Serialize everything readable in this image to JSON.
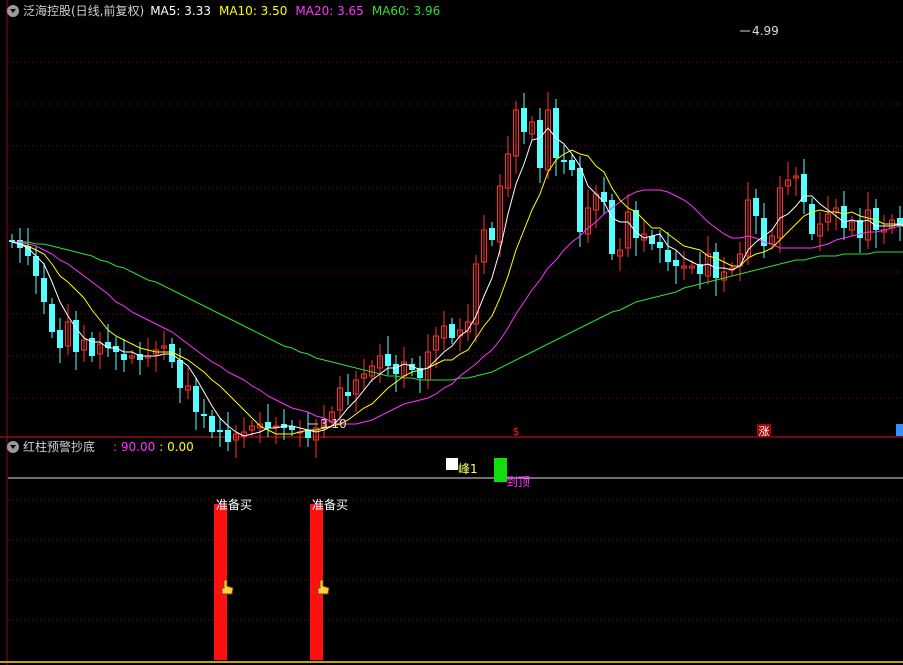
{
  "main_panel": {
    "title": "泛海控股(日线,前复权)",
    "ma_items": [
      {
        "label": "MA5",
        "value": "3.33",
        "color": "#ffffff"
      },
      {
        "label": "MA10",
        "value": "3.50",
        "color": "#ffff00"
      },
      {
        "label": "MA20",
        "value": "3.65",
        "color": "#ff33ff"
      },
      {
        "label": "MA60",
        "value": "3.96",
        "color": "#33dd33"
      }
    ]
  },
  "indicator_panel": {
    "title": "红柱预警抄底",
    "values": [
      {
        "text": ": 90.00",
        "color": "#ff33ff"
      },
      {
        "text": ": 0.00",
        "color": "#ffff00"
      }
    ]
  },
  "chart_data": {
    "type": "candlestick",
    "price_range": [
      3.0,
      5.05
    ],
    "high_marker": {
      "value": "4.99",
      "index": 91
    },
    "low_marker": {
      "value": "3.10",
      "index": 37
    },
    "event_markers": [
      {
        "text": "$",
        "index": 63,
        "color": "#ff2020"
      },
      {
        "text": "涨",
        "index": 94,
        "color": "#ffffff",
        "bg": "#aa0000"
      }
    ],
    "close": [
      3.95,
      3.92,
      3.88,
      3.78,
      3.65,
      3.5,
      3.42,
      3.55,
      3.4,
      3.46,
      3.38,
      3.44,
      3.42,
      3.4,
      3.36,
      3.38,
      3.36,
      3.38,
      3.41,
      3.43,
      3.35,
      3.22,
      3.23,
      3.1,
      3.08,
      3.0,
      3.0,
      2.95,
      2.99,
      3.0,
      3.03,
      3.04,
      3.02,
      3.03,
      3.02,
      3.01,
      3.0,
      2.97,
      3.02,
      3.06,
      3.1,
      3.22,
      3.18,
      3.26,
      3.29,
      3.33,
      3.38,
      3.33,
      3.29,
      3.35,
      3.31,
      3.27,
      3.4,
      3.48,
      3.53,
      3.47,
      3.51,
      3.55,
      3.84,
      4.01,
      3.96,
      4.23,
      4.39,
      4.61,
      4.5,
      4.55,
      4.32,
      4.61,
      4.37,
      4.35,
      4.31,
      4.0,
      4.12,
      4.19,
      4.15,
      3.89,
      3.91,
      4.1,
      3.97,
      3.99,
      3.94,
      3.92,
      3.85,
      3.83,
      3.83,
      3.83,
      3.79,
      3.89,
      3.77,
      3.8,
      3.82,
      3.89,
      4.16,
      4.08,
      3.93,
      3.98,
      4.22,
      4.26,
      4.28,
      4.15,
      3.99,
      4.04,
      4.09,
      4.12,
      4.02,
      4.05,
      3.97,
      4.11,
      4.01,
      4.01,
      4.06,
      4.03,
      3.93
    ],
    "open": [
      3.96,
      3.96,
      3.93,
      3.88,
      3.77,
      3.64,
      3.51,
      3.43,
      3.56,
      3.41,
      3.47,
      3.39,
      3.45,
      3.43,
      3.39,
      3.37,
      3.39,
      3.37,
      3.39,
      3.42,
      3.44,
      3.36,
      3.21,
      3.23,
      3.09,
      3.08,
      3.01,
      3.01,
      2.96,
      2.98,
      3.01,
      3.02,
      3.05,
      3.03,
      3.04,
      3.03,
      3.0,
      3.01,
      2.96,
      3.03,
      3.05,
      3.11,
      3.2,
      3.19,
      3.27,
      3.28,
      3.32,
      3.39,
      3.34,
      3.28,
      3.34,
      3.32,
      3.26,
      3.41,
      3.47,
      3.54,
      3.48,
      3.5,
      3.54,
      3.85,
      4.02,
      3.95,
      4.22,
      4.38,
      4.62,
      4.49,
      4.56,
      4.31,
      4.62,
      4.36,
      4.36,
      4.32,
      3.99,
      4.11,
      4.2,
      4.16,
      3.88,
      3.92,
      4.11,
      3.96,
      3.98,
      3.95,
      3.91,
      3.86,
      3.82,
      3.82,
      3.84,
      3.78,
      3.9,
      3.76,
      3.81,
      3.83,
      3.88,
      4.17,
      4.07,
      3.94,
      3.97,
      4.23,
      4.27,
      4.29,
      4.14,
      3.98,
      4.05,
      4.1,
      4.13,
      4.01,
      4.06,
      3.96,
      4.12,
      4.0,
      4.02,
      4.07,
      4.04
    ],
    "ma5": [
      3.95,
      3.94,
      3.92,
      3.88,
      3.84,
      3.75,
      3.65,
      3.58,
      3.52,
      3.47,
      3.45,
      3.45,
      3.42,
      3.42,
      3.4,
      3.4,
      3.38,
      3.38,
      3.38,
      3.39,
      3.39,
      3.36,
      3.33,
      3.27,
      3.2,
      3.13,
      3.07,
      3.03,
      3.0,
      2.98,
      2.99,
      3.0,
      3.02,
      3.02,
      3.03,
      3.03,
      3.02,
      3.01,
      3.0,
      3.01,
      3.03,
      3.07,
      3.12,
      3.16,
      3.21,
      3.26,
      3.29,
      3.32,
      3.32,
      3.34,
      3.33,
      3.31,
      3.32,
      3.36,
      3.4,
      3.43,
      3.48,
      3.51,
      3.58,
      3.68,
      3.77,
      3.91,
      4.09,
      4.24,
      4.34,
      4.46,
      4.47,
      4.52,
      4.47,
      4.44,
      4.39,
      4.33,
      4.23,
      4.19,
      4.15,
      4.07,
      4.05,
      4.05,
      4.0,
      3.97,
      3.98,
      3.99,
      3.93,
      3.91,
      3.87,
      3.85,
      3.83,
      3.84,
      3.82,
      3.82,
      3.81,
      3.83,
      3.91,
      3.95,
      3.98,
      4.01,
      4.07,
      4.09,
      4.13,
      4.18,
      4.18,
      4.14,
      4.11,
      4.08,
      4.05,
      4.06,
      4.05,
      4.06,
      4.03,
      4.03,
      4.03,
      4.04,
      4.01
    ],
    "ma10": [
      3.95,
      3.94,
      3.93,
      3.91,
      3.89,
      3.84,
      3.78,
      3.75,
      3.71,
      3.67,
      3.61,
      3.56,
      3.51,
      3.48,
      3.46,
      3.44,
      3.42,
      3.41,
      3.4,
      3.4,
      3.4,
      3.38,
      3.36,
      3.33,
      3.3,
      3.26,
      3.23,
      3.19,
      3.15,
      3.11,
      3.07,
      3.03,
      3.01,
      2.99,
      2.99,
      2.99,
      3.0,
      3.01,
      3.01,
      3.02,
      3.03,
      3.04,
      3.06,
      3.09,
      3.12,
      3.14,
      3.18,
      3.22,
      3.25,
      3.28,
      3.3,
      3.31,
      3.32,
      3.34,
      3.36,
      3.36,
      3.39,
      3.41,
      3.47,
      3.53,
      3.58,
      3.67,
      3.78,
      3.91,
      4.01,
      4.11,
      4.19,
      4.3,
      4.36,
      4.39,
      4.41,
      4.39,
      4.38,
      4.33,
      4.3,
      4.22,
      4.16,
      4.12,
      4.1,
      4.06,
      4.02,
      4.02,
      3.99,
      3.96,
      3.93,
      3.92,
      3.91,
      3.88,
      3.87,
      3.85,
      3.83,
      3.83,
      3.87,
      3.89,
      3.9,
      3.92,
      3.96,
      4.0,
      4.04,
      4.08,
      4.1,
      4.11,
      4.1,
      4.1,
      4.09,
      4.1,
      4.08,
      4.07,
      4.06,
      4.04,
      4.04,
      4.04,
      4.03
    ],
    "ma20": [
      3.95,
      3.95,
      3.94,
      3.93,
      3.91,
      3.89,
      3.86,
      3.84,
      3.81,
      3.78,
      3.75,
      3.72,
      3.69,
      3.65,
      3.63,
      3.6,
      3.58,
      3.56,
      3.54,
      3.52,
      3.5,
      3.47,
      3.44,
      3.41,
      3.38,
      3.35,
      3.33,
      3.3,
      3.28,
      3.26,
      3.23,
      3.21,
      3.18,
      3.16,
      3.14,
      3.12,
      3.11,
      3.1,
      3.08,
      3.07,
      3.05,
      3.04,
      3.04,
      3.04,
      3.05,
      3.06,
      3.08,
      3.1,
      3.12,
      3.14,
      3.15,
      3.16,
      3.17,
      3.19,
      3.22,
      3.24,
      3.28,
      3.31,
      3.34,
      3.38,
      3.41,
      3.46,
      3.52,
      3.59,
      3.65,
      3.71,
      3.76,
      3.82,
      3.86,
      3.91,
      3.95,
      3.98,
      4.02,
      4.05,
      4.09,
      4.12,
      4.15,
      4.18,
      4.2,
      4.21,
      4.21,
      4.21,
      4.2,
      4.18,
      4.16,
      4.13,
      4.09,
      4.05,
      4.02,
      3.99,
      3.97,
      3.97,
      3.98,
      3.97,
      3.95,
      3.94,
      3.92,
      3.92,
      3.92,
      3.92,
      3.92,
      3.93,
      3.94,
      3.96,
      3.97,
      3.98,
      3.99,
      4.0,
      4.0,
      4.01,
      4.02,
      4.03,
      4.03
    ],
    "ma60": [
      3.95,
      3.95,
      3.95,
      3.94,
      3.94,
      3.93,
      3.92,
      3.91,
      3.9,
      3.89,
      3.88,
      3.86,
      3.85,
      3.83,
      3.82,
      3.8,
      3.78,
      3.76,
      3.75,
      3.73,
      3.71,
      3.69,
      3.67,
      3.65,
      3.63,
      3.61,
      3.59,
      3.57,
      3.55,
      3.53,
      3.51,
      3.49,
      3.47,
      3.45,
      3.43,
      3.42,
      3.4,
      3.39,
      3.37,
      3.36,
      3.35,
      3.34,
      3.33,
      3.32,
      3.31,
      3.3,
      3.29,
      3.28,
      3.28,
      3.27,
      3.27,
      3.26,
      3.26,
      3.26,
      3.26,
      3.26,
      3.27,
      3.27,
      3.28,
      3.29,
      3.3,
      3.32,
      3.34,
      3.36,
      3.38,
      3.4,
      3.42,
      3.44,
      3.46,
      3.48,
      3.5,
      3.52,
      3.54,
      3.56,
      3.58,
      3.6,
      3.61,
      3.63,
      3.65,
      3.66,
      3.67,
      3.68,
      3.69,
      3.7,
      3.72,
      3.73,
      3.74,
      3.75,
      3.76,
      3.77,
      3.78,
      3.79,
      3.8,
      3.81,
      3.82,
      3.83,
      3.84,
      3.85,
      3.86,
      3.86,
      3.87,
      3.88,
      3.88,
      3.88,
      3.89,
      3.89,
      3.89,
      3.89,
      3.9,
      3.9,
      3.9,
      3.9,
      3.9
    ],
    "indicator": {
      "signals": [
        {
          "type": "square",
          "index": 55,
          "color": "#ffffff"
        },
        {
          "type": "text",
          "text": "峰1",
          "index": 56,
          "color": "#ffff66"
        },
        {
          "type": "bar",
          "index": 61,
          "color": "#11dd11"
        },
        {
          "type": "text",
          "text": "到顶",
          "index": 62,
          "color": "#ff33ff"
        }
      ],
      "red_bars": [
        {
          "index": 26,
          "label": "准备买",
          "color": "#ff1010"
        },
        {
          "index": 38,
          "label": "准备买",
          "color": "#ff1010"
        }
      ]
    }
  }
}
